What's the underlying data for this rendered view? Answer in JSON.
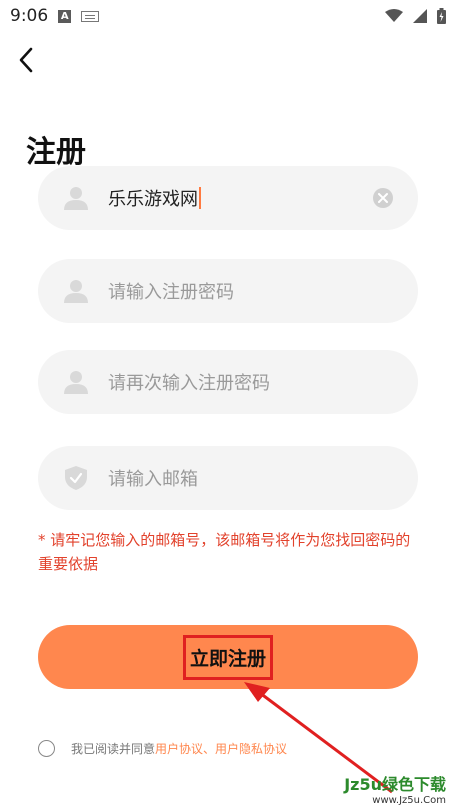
{
  "status_bar": {
    "time": "9:06",
    "a_label": "A"
  },
  "page": {
    "title": "注册"
  },
  "form": {
    "username_value": "乐乐游戏网",
    "password_placeholder": "请输入注册密码",
    "confirm_password_placeholder": "请再次输入注册密码",
    "email_placeholder": "请输入邮箱"
  },
  "notice": {
    "text": "* 请牢记您输入的邮箱号，该邮箱号将作为您找回密码的重要依据"
  },
  "submit": {
    "label": "立即注册"
  },
  "agreement": {
    "prefix": "我已阅读并同意",
    "user_agreement": "用户协议",
    "separator": "、",
    "privacy_agreement": "用户隐私协议"
  },
  "watermark": {
    "line1": "Jz5u绿色下载",
    "line2": "www.Jz5u.Com"
  },
  "colors": {
    "accent": "#ff874e",
    "warning": "#e2422c",
    "field_bg": "#f4f4f4"
  }
}
